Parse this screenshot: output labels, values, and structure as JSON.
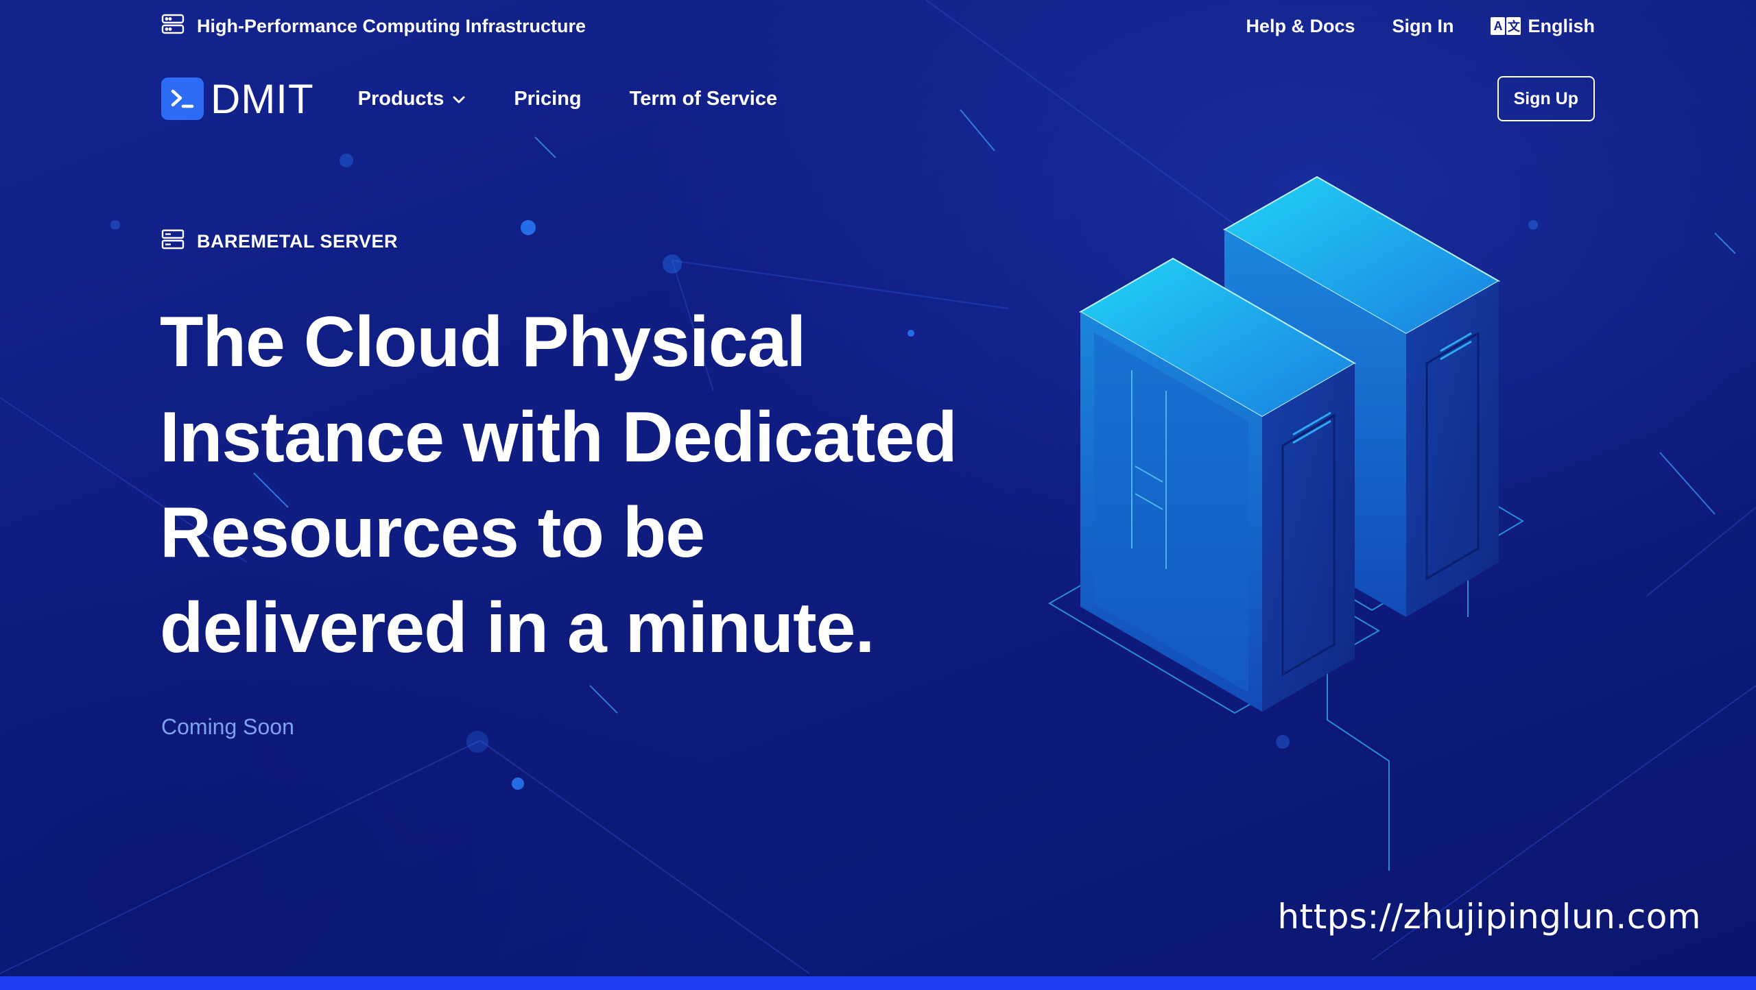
{
  "utility_bar": {
    "tagline": "High-Performance Computing Infrastructure",
    "help_docs": "Help & Docs",
    "sign_in": "Sign In",
    "language": "English",
    "language_icon_glyphs": [
      "A",
      "文"
    ]
  },
  "nav": {
    "logo_text": "DMIT",
    "items": [
      {
        "label": "Products",
        "has_dropdown": true
      },
      {
        "label": "Pricing"
      },
      {
        "label": "Term of Service"
      }
    ],
    "sign_up": "Sign Up"
  },
  "hero": {
    "eyebrow": "BAREMETAL SERVER",
    "headline_lines": [
      "The Cloud Physical",
      "Instance with Dedicated",
      "Resources to be",
      "delivered in a minute."
    ],
    "status": "Coming Soon"
  },
  "watermark": "https://zhujipinglun.com",
  "colors": {
    "background": "#0d1a7a",
    "accent": "#2f6cf6",
    "bottom_bar": "#1f3df0",
    "muted_text": "#7ea3ee",
    "server_cyan": "#1fb7f0"
  },
  "icons": {
    "tagline_icon": "server-rack-icon",
    "eyebrow_icon": "server-rack-icon",
    "language_icon": "translate-icon",
    "dropdown_icon": "chevron-down-icon",
    "logo_icon": "terminal-prompt-icon"
  }
}
